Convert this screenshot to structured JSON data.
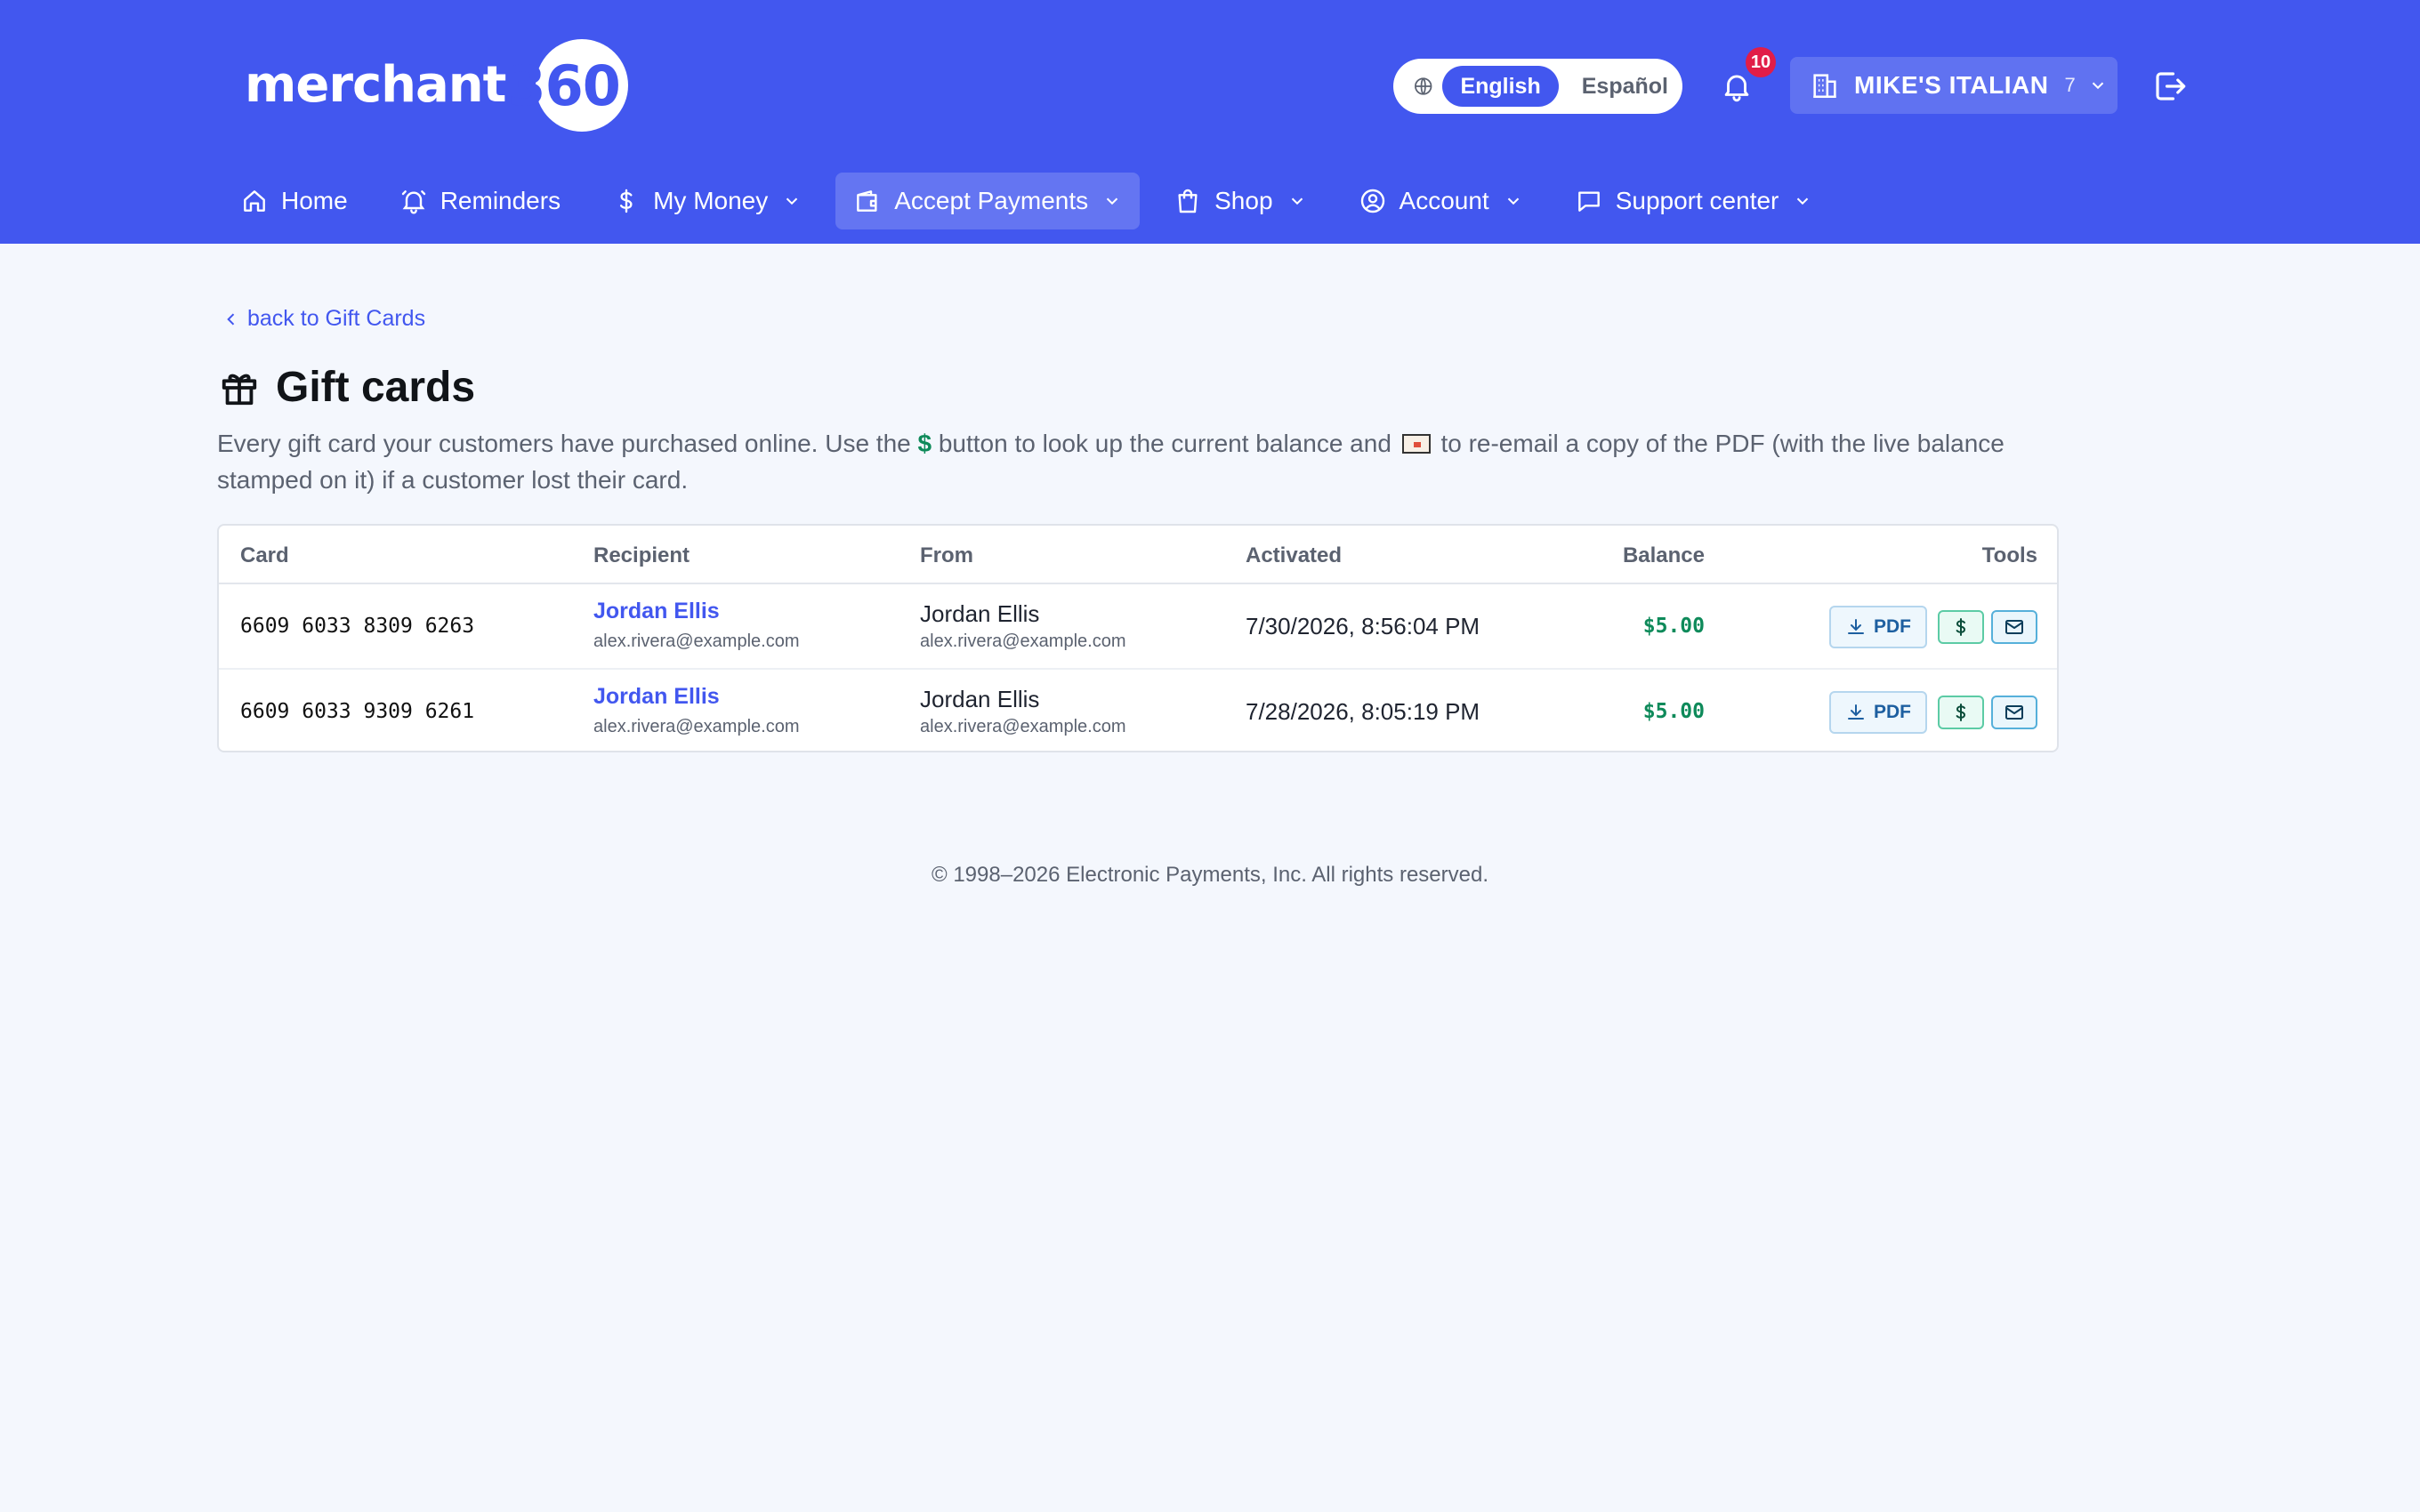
{
  "brand": {
    "logo_text": "merchant",
    "logo_number": "360"
  },
  "language": {
    "active": "English",
    "other": "Español"
  },
  "notifications": {
    "count": "10"
  },
  "merchant": {
    "name": "MIKE'S ITALIAN",
    "count": "7"
  },
  "nav": {
    "items": [
      {
        "label": "Home"
      },
      {
        "label": "Reminders"
      },
      {
        "label": "My Money"
      },
      {
        "label": "Accept Payments"
      },
      {
        "label": "Shop"
      },
      {
        "label": "Account"
      },
      {
        "label": "Support center"
      }
    ]
  },
  "page": {
    "back_link": "back to Gift Cards",
    "title": "Gift cards",
    "desc_part1": "Every gift card your customers have purchased online. Use the ",
    "desc_dollar": "$",
    "desc_part2": " button to look up the current balance and ",
    "desc_part3": " to re-email a copy of the PDF (with the live balance stamped on it) if a customer lost their card."
  },
  "table": {
    "headers": {
      "card": "Card",
      "recipient": "Recipient",
      "from": "From",
      "activated": "Activated",
      "balance": "Balance",
      "tools": "Tools"
    },
    "rows": [
      {
        "card": "6609 6033 8309 6263",
        "recipient_name": "Jordan Ellis",
        "recipient_email": "alex.rivera@example.com",
        "from_name": "Jordan Ellis",
        "from_email": "alex.rivera@example.com",
        "activated": "7/30/2026, 8:56:04 PM",
        "balance": "$5.00",
        "pdf_label": "PDF"
      },
      {
        "card": "6609 6033 9309 6261",
        "recipient_name": "Jordan Ellis",
        "recipient_email": "alex.rivera@example.com",
        "from_name": "Jordan Ellis",
        "from_email": "alex.rivera@example.com",
        "activated": "7/28/2026, 8:05:19 PM",
        "balance": "$5.00",
        "pdf_label": "PDF"
      }
    ]
  },
  "footer": {
    "text": "© 1998–2026 Electronic Payments, Inc. All rights reserved."
  },
  "colors": {
    "brand": "#4257ef",
    "balance_green": "#0e8a5a",
    "badge_red": "#e11d48"
  }
}
